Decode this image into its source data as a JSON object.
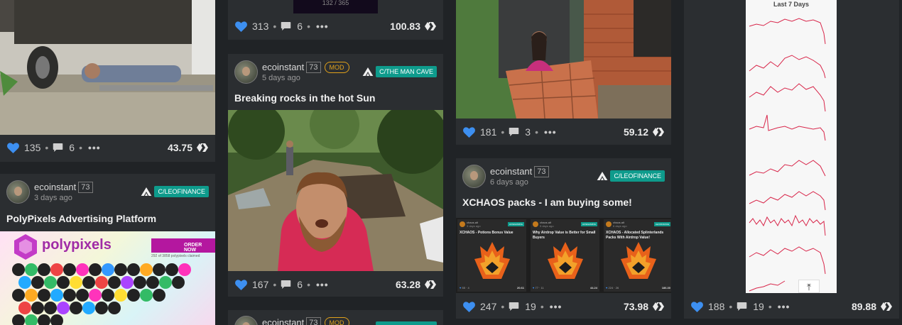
{
  "posts": [
    {
      "likes": "135",
      "comments": "6",
      "more": "•••",
      "value": "43.75"
    },
    {
      "author": "ecoinstant",
      "rep": "73",
      "ago": "3 days ago",
      "community": "C/LEOFINANCE",
      "title": "PolyPixels Advertising Platform",
      "thumb": {
        "brand": "polypixels",
        "button": "ORDER NOW",
        "subtext": "292 of 3858 polypixels claimed"
      }
    },
    {
      "likes": "313",
      "comments": "6",
      "more": "•••",
      "value": "100.83",
      "thumb_caption": "132 / 365"
    },
    {
      "author": "ecoinstant",
      "rep": "73",
      "badge": "MOD",
      "ago": "5 days ago",
      "community": "C/THE MAN CAVE",
      "title": "Breaking rocks in the hot Sun",
      "likes": "167",
      "comments": "6",
      "more": "•••",
      "value": "63.28"
    },
    {
      "author": "ecoinstant",
      "rep": "73",
      "badge": "MOD"
    },
    {
      "likes": "181",
      "comments": "3",
      "more": "•••",
      "value": "59.12"
    },
    {
      "author": "ecoinstant",
      "rep": "73",
      "ago": "6 days ago",
      "community": "C/LEOFINANCE",
      "title": "XCHAOS packs - I am buying some!",
      "likes": "247",
      "comments": "19",
      "more": "•••",
      "value": "73.98",
      "thumb": [
        {
          "user": "chaos.alt",
          "ago": "3 days ago",
          "tag": "HIVEGAMING",
          "title": "XCHAOS - Potions Bonus Value",
          "likes": "55",
          "comments": "4",
          "value": "20.61"
        },
        {
          "user": "chaos.alt",
          "ago": "5 days ago",
          "tag": "HIVEGAMING",
          "title": "Why Airdrop Value is Better for Small Buyers",
          "likes": "77",
          "comments": "11",
          "value": "44.24"
        },
        {
          "user": "chaos.alt",
          "ago": "6 days ago",
          "tag": "LEOFINANCE",
          "title": "XCHAOS - Allocated Splinterlands Packs With Airdrop Value!",
          "likes": "224",
          "comments": "26",
          "value": "186.30"
        }
      ]
    },
    {
      "thumb_title": "Last 7 Days",
      "likes": "188",
      "comments": "19",
      "more": "•••",
      "value": "89.88"
    }
  ]
}
